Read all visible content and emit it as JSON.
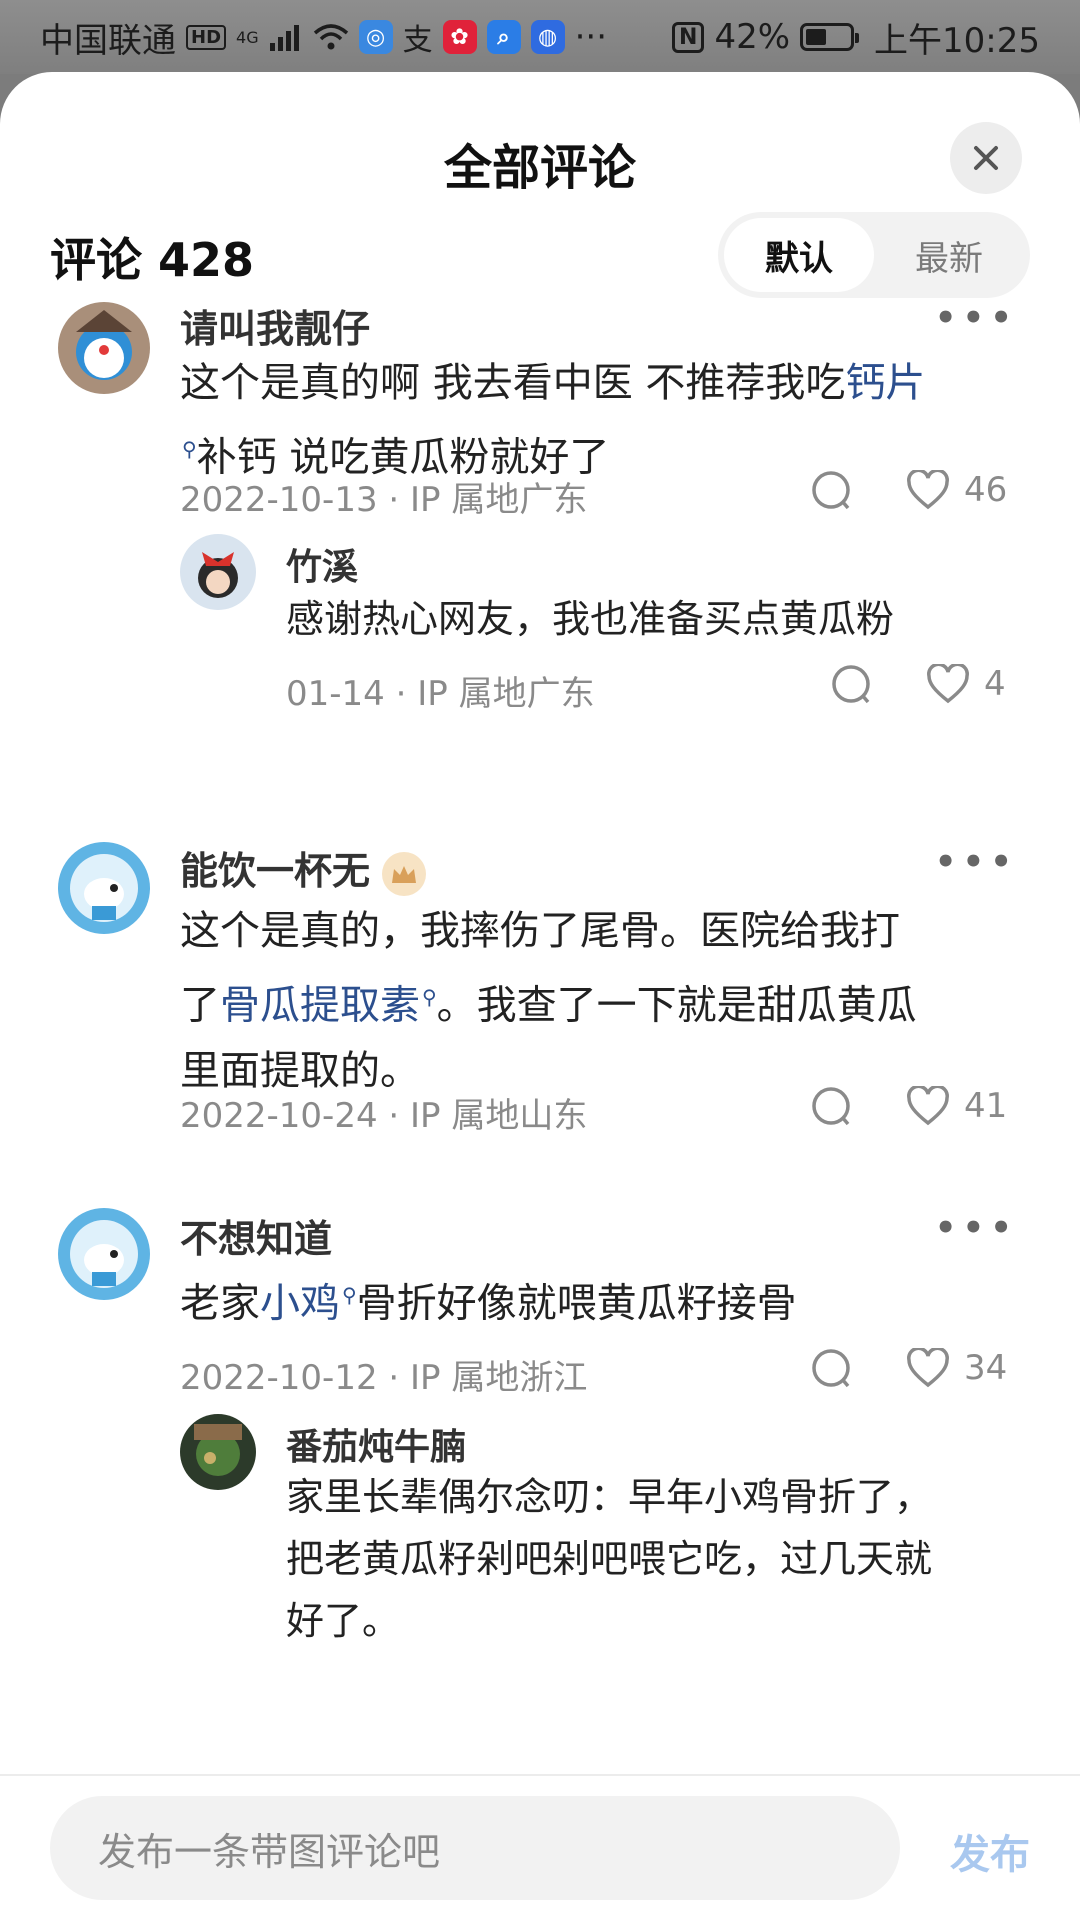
{
  "status_bar": {
    "carrier": "中国联通",
    "hd": "HD",
    "network": "4G",
    "battery": "42%",
    "time": "上午10:25"
  },
  "sheet": {
    "title": "全部评论",
    "comment_count_label": "评论 428",
    "sort_options": [
      "默认",
      "最新"
    ]
  },
  "comments": [
    {
      "author": "请叫我靓仔",
      "text_parts": [
        "这个是真的啊 我去看中医 不推荐我吃",
        "钙片",
        "补钙 说吃黄瓜粉就好了"
      ],
      "date": "2022-10-13",
      "ip": "IP 属地广东",
      "likes": "46",
      "reply": {
        "author": "竹溪",
        "text": "感谢热心网友，我也准备买点黄瓜粉",
        "date": "01-14",
        "ip": "IP 属地广东",
        "likes": "4"
      }
    },
    {
      "author": "能饮一杯无",
      "text_line1": "这个是真的，我摔伤了尾骨。医院给我打",
      "text_line2_parts": [
        "了",
        "骨瓜提取素",
        "。我查了一下就是甜瓜黄瓜"
      ],
      "text_line3": "里面提取的。",
      "date": "2022-10-24",
      "ip": "IP 属地山东",
      "likes": "41"
    },
    {
      "author": "不想知道",
      "text_parts": [
        "老家",
        "小鸡",
        "骨折好像就喂黄瓜籽接骨"
      ],
      "date": "2022-10-12",
      "ip": "IP 属地浙江",
      "likes": "34",
      "reply": {
        "author": "番茄炖牛腩",
        "text_lines": [
          "家里长辈偶尔念叨：早年小鸡骨折了，",
          "把老黄瓜籽剁吧剁吧喂它吃，过几天就",
          "好了。"
        ]
      }
    }
  ],
  "bottom_bar": {
    "placeholder": "发布一条带图评论吧",
    "publish": "发布"
  }
}
